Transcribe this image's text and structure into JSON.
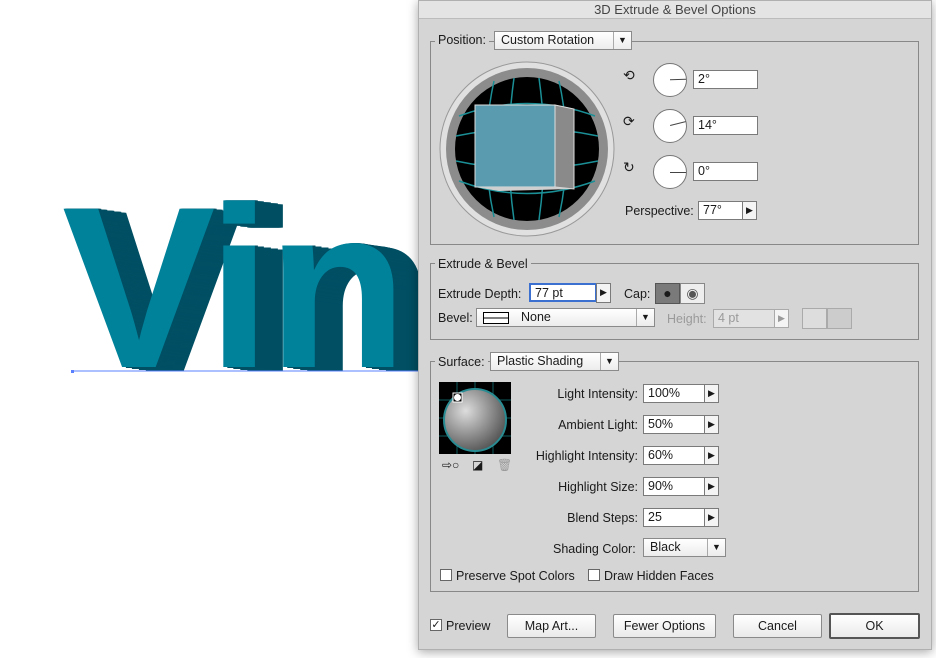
{
  "canvas": {
    "artwork_text": "Vin",
    "colors": {
      "front": "#00829b",
      "side": "#004f63"
    }
  },
  "dialog": {
    "title": "3D Extrude & Bevel Options",
    "position": {
      "label": "Position:",
      "value": "Custom Rotation",
      "rotations": [
        {
          "axis": "x",
          "value": "2°"
        },
        {
          "axis": "y",
          "value": "14°"
        },
        {
          "axis": "z",
          "value": "0°"
        }
      ],
      "perspective_label": "Perspective:",
      "perspective": "77°"
    },
    "extrude": {
      "group": "Extrude & Bevel",
      "depth_label": "Extrude Depth:",
      "depth": "77 pt",
      "cap_label": "Cap:",
      "bevel_label": "Bevel:",
      "bevel": "None",
      "height_label": "Height:",
      "height": "4 pt"
    },
    "surface": {
      "label": "Surface:",
      "value": "Plastic Shading",
      "settings": [
        {
          "label": "Light Intensity:",
          "value": "100%"
        },
        {
          "label": "Ambient Light:",
          "value": "50%"
        },
        {
          "label": "Highlight Intensity:",
          "value": "60%"
        },
        {
          "label": "Highlight Size:",
          "value": "90%"
        },
        {
          "label": "Blend Steps:",
          "value": "25"
        }
      ],
      "shading_color_label": "Shading Color:",
      "shading_color": "Black",
      "preserve_spot": "Preserve Spot Colors",
      "draw_hidden": "Draw Hidden Faces"
    },
    "preview": {
      "label": "Preview",
      "checked": true
    },
    "buttons": {
      "map_art": "Map Art...",
      "fewer": "Fewer Options",
      "cancel": "Cancel",
      "ok": "OK"
    }
  }
}
